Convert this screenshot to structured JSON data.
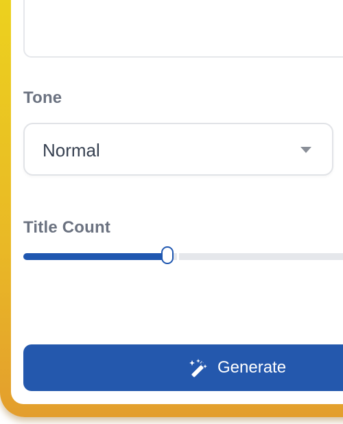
{
  "form": {
    "tone": {
      "label": "Tone",
      "selected": "Normal"
    },
    "title_count": {
      "label": "Title Count",
      "level_fraction": 0.41
    },
    "generate_button": {
      "label": "Generate",
      "icon": "magic-wand-icon"
    }
  },
  "colors": {
    "accent": "#2458ad",
    "frame": "#e9b826"
  }
}
